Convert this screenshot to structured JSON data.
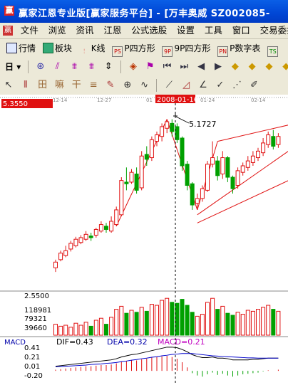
{
  "window": {
    "title": "赢家江恩专业版[赢家服务平台] - [万丰奥威   SZ002085-",
    "app_icon": "赢"
  },
  "menu": [
    "文件",
    "浏览",
    "资讯",
    "江恩",
    "公式选股",
    "设置",
    "工具",
    "窗口",
    "交易委托"
  ],
  "toolbar1": [
    {
      "icon": "grid-icon",
      "label": "行情"
    },
    {
      "icon": "blocks-icon",
      "label": "板块"
    },
    {
      "icon": "candle-icon",
      "label": "K线"
    },
    {
      "icon": "ps-icon",
      "icon_text": "PS",
      "label": "P四方形"
    },
    {
      "icon": "9p-icon",
      "icon_text": "9P",
      "label": "9P四方形"
    },
    {
      "icon": "pn-icon",
      "icon_text": "PN",
      "label": "P数字表"
    },
    {
      "icon": "ts-icon",
      "icon_text": "TS",
      "label": ""
    }
  ],
  "toolbar2": {
    "period": "日",
    "icons": [
      "indicator-icon",
      "line-chart-icon",
      "kline-icon",
      "candle-small-icon",
      "select-icon",
      "zoom-icon",
      "flag-icon",
      "first-icon",
      "prev-icon",
      "play-left-icon",
      "play-right-icon",
      "diamond-up-icon",
      "diamond-left-icon",
      "diamond-right-icon",
      "diamond-down-icon"
    ]
  },
  "toolbar3": {
    "icons": [
      "cursor-icon",
      "vertical-lines-icon",
      "gann-grid-icon",
      "gann-box-icon",
      "gann-fan-icon",
      "fibonacci-icon",
      "pen-icon",
      "circle-cross-icon",
      "sine-wave-icon",
      "fan-lines-icon",
      "triangle-icon",
      "angle-icon",
      "checkmark-icon",
      "zigzag-icon",
      "pencil-icon"
    ]
  },
  "chart": {
    "price_label": "5.3550",
    "cursor_date": "2008-01-16",
    "date_ticks": [
      "12-14",
      "12-27",
      "01",
      "01-24",
      "02-14"
    ],
    "peak_label": "5.1727",
    "volume_axis": [
      "2.5500",
      "118981",
      "79321",
      "39660"
    ],
    "macd": {
      "title": "MACD",
      "dif": "DIF=0.43",
      "dea": "DEA=0.32",
      "macd": "MACD=0.21"
    },
    "macd_axis": [
      "0.41",
      "0.21",
      "0.01",
      "-0.20"
    ],
    "colors": {
      "up": "#e01010",
      "down": "#00a000",
      "cursor_label": "#e01010",
      "macd_text": "#c000c0"
    }
  },
  "chart_data": {
    "type": "candlestick",
    "candles": [
      {
        "o": 3.35,
        "c": 3.42,
        "h": 3.45,
        "l": 3.3
      },
      {
        "o": 3.45,
        "c": 3.53,
        "h": 3.56,
        "l": 3.43
      },
      {
        "o": 3.5,
        "c": 3.56,
        "h": 3.62,
        "l": 3.48
      },
      {
        "o": 3.58,
        "c": 3.65,
        "h": 3.68,
        "l": 3.55
      },
      {
        "o": 3.62,
        "c": 3.7,
        "h": 3.73,
        "l": 3.6
      },
      {
        "o": 3.66,
        "c": 3.72,
        "h": 3.75,
        "l": 3.64
      },
      {
        "o": 3.7,
        "c": 3.76,
        "h": 3.8,
        "l": 3.68
      },
      {
        "o": 3.74,
        "c": 3.72,
        "h": 3.78,
        "l": 3.68
      },
      {
        "o": 3.75,
        "c": 3.82,
        "h": 3.84,
        "l": 3.72
      },
      {
        "o": 3.8,
        "c": 3.88,
        "h": 3.92,
        "l": 3.78
      },
      {
        "o": 3.86,
        "c": 3.82,
        "h": 3.9,
        "l": 3.78
      },
      {
        "o": 3.8,
        "c": 3.92,
        "h": 3.98,
        "l": 3.78
      },
      {
        "o": 3.88,
        "c": 4.06,
        "h": 4.1,
        "l": 3.86
      },
      {
        "o": 4.0,
        "c": 4.42,
        "h": 4.46,
        "l": 3.98
      },
      {
        "o": 4.4,
        "c": 4.38,
        "h": 4.58,
        "l": 4.3
      },
      {
        "o": 4.4,
        "c": 4.52,
        "h": 4.56,
        "l": 4.38
      },
      {
        "o": 4.5,
        "c": 4.3,
        "h": 4.58,
        "l": 4.26
      },
      {
        "o": 4.33,
        "c": 4.72,
        "h": 4.78,
        "l": 4.3
      },
      {
        "o": 4.74,
        "c": 4.68,
        "h": 4.84,
        "l": 4.6
      },
      {
        "o": 4.7,
        "c": 4.92,
        "h": 4.96,
        "l": 4.66
      },
      {
        "o": 4.9,
        "c": 4.98,
        "h": 5.02,
        "l": 4.84
      },
      {
        "o": 4.96,
        "c": 5.08,
        "h": 5.12,
        "l": 4.9
      },
      {
        "o": 5.06,
        "c": 5.14,
        "h": 5.17,
        "l": 5.0
      },
      {
        "o": 5.12,
        "c": 5.02,
        "h": 5.17,
        "l": 4.96
      },
      {
        "o": 5.08,
        "c": 4.92,
        "h": 5.12,
        "l": 4.88
      },
      {
        "o": 4.94,
        "c": 4.6,
        "h": 4.96,
        "l": 4.54
      },
      {
        "o": 4.62,
        "c": 4.36,
        "h": 4.66,
        "l": 4.3
      },
      {
        "o": 4.38,
        "c": 4.12,
        "h": 4.4,
        "l": 4.06
      },
      {
        "o": 4.14,
        "c": 4.2,
        "h": 4.26,
        "l": 4.08
      },
      {
        "o": 4.2,
        "c": 4.32,
        "h": 4.36,
        "l": 4.16
      },
      {
        "o": 4.3,
        "c": 4.62,
        "h": 4.66,
        "l": 4.28
      },
      {
        "o": 4.62,
        "c": 4.7,
        "h": 4.9,
        "l": 4.58
      },
      {
        "o": 4.66,
        "c": 4.48,
        "h": 4.72,
        "l": 4.42
      },
      {
        "o": 4.5,
        "c": 4.7,
        "h": 4.78,
        "l": 4.44
      },
      {
        "o": 4.7,
        "c": 4.46,
        "h": 4.72,
        "l": 4.4
      },
      {
        "o": 4.46,
        "c": 4.32,
        "h": 4.48,
        "l": 4.26
      },
      {
        "o": 4.36,
        "c": 4.54,
        "h": 4.58,
        "l": 4.32
      },
      {
        "o": 4.52,
        "c": 4.6,
        "h": 4.64,
        "l": 4.48
      },
      {
        "o": 4.58,
        "c": 4.66,
        "h": 4.72,
        "l": 4.54
      },
      {
        "o": 4.64,
        "c": 4.72,
        "h": 4.78,
        "l": 4.6
      },
      {
        "o": 4.7,
        "c": 4.78,
        "h": 4.82,
        "l": 4.66
      },
      {
        "o": 4.76,
        "c": 4.88,
        "h": 4.94,
        "l": 4.72
      },
      {
        "o": 4.86,
        "c": 4.98,
        "h": 5.02,
        "l": 4.82
      },
      {
        "o": 4.96,
        "c": 4.84,
        "h": 5.04,
        "l": 4.8
      },
      {
        "o": 4.86,
        "c": 4.96,
        "h": 5.0,
        "l": 4.82
      }
    ],
    "volume": [
      22,
      18,
      20,
      16,
      24,
      20,
      26,
      18,
      30,
      34,
      22,
      36,
      52,
      58,
      44,
      50,
      46,
      56,
      48,
      62,
      60,
      70,
      74,
      66,
      64,
      72,
      60,
      46,
      38,
      42,
      66,
      74,
      52,
      58,
      44,
      40,
      46,
      42,
      50,
      48,
      52,
      56,
      60,
      52,
      48
    ],
    "macd_bars": [
      0.02,
      0.03,
      0.04,
      0.05,
      0.06,
      0.07,
      0.08,
      0.08,
      0.09,
      0.1,
      0.1,
      0.11,
      0.13,
      0.16,
      0.17,
      0.18,
      0.18,
      0.2,
      0.21,
      0.23,
      0.24,
      0.25,
      0.26,
      0.24,
      0.21,
      0.15,
      0.06,
      -0.04,
      -0.08,
      -0.1,
      -0.06,
      -0.03,
      -0.07,
      -0.05,
      -0.08,
      -0.1,
      -0.08,
      -0.06,
      -0.05,
      -0.04,
      -0.03,
      -0.01,
      0.01,
      0.0,
      0.02
    ],
    "dif": [
      0.08,
      0.09,
      0.1,
      0.11,
      0.12,
      0.13,
      0.14,
      0.15,
      0.16,
      0.17,
      0.18,
      0.19,
      0.21,
      0.24,
      0.26,
      0.28,
      0.29,
      0.31,
      0.33,
      0.35,
      0.37,
      0.39,
      0.41,
      0.41,
      0.4,
      0.37,
      0.33,
      0.28,
      0.25,
      0.23,
      0.23,
      0.24,
      0.22,
      0.22,
      0.21,
      0.19,
      0.19,
      0.19,
      0.19,
      0.2,
      0.2,
      0.21,
      0.22,
      0.22,
      0.22
    ],
    "dea": [
      0.07,
      0.075,
      0.08,
      0.085,
      0.09,
      0.095,
      0.1,
      0.11,
      0.115,
      0.12,
      0.13,
      0.135,
      0.145,
      0.16,
      0.17,
      0.185,
      0.195,
      0.21,
      0.22,
      0.235,
      0.245,
      0.26,
      0.27,
      0.285,
      0.29,
      0.3,
      0.3,
      0.3,
      0.29,
      0.28,
      0.27,
      0.26,
      0.255,
      0.25,
      0.245,
      0.24,
      0.235,
      0.23,
      0.225,
      0.225,
      0.22,
      0.22,
      0.22,
      0.22,
      0.22
    ],
    "price_range": [
      3.1,
      5.35
    ],
    "macd_range": [
      -0.22,
      0.42
    ],
    "peak_index": 22
  }
}
